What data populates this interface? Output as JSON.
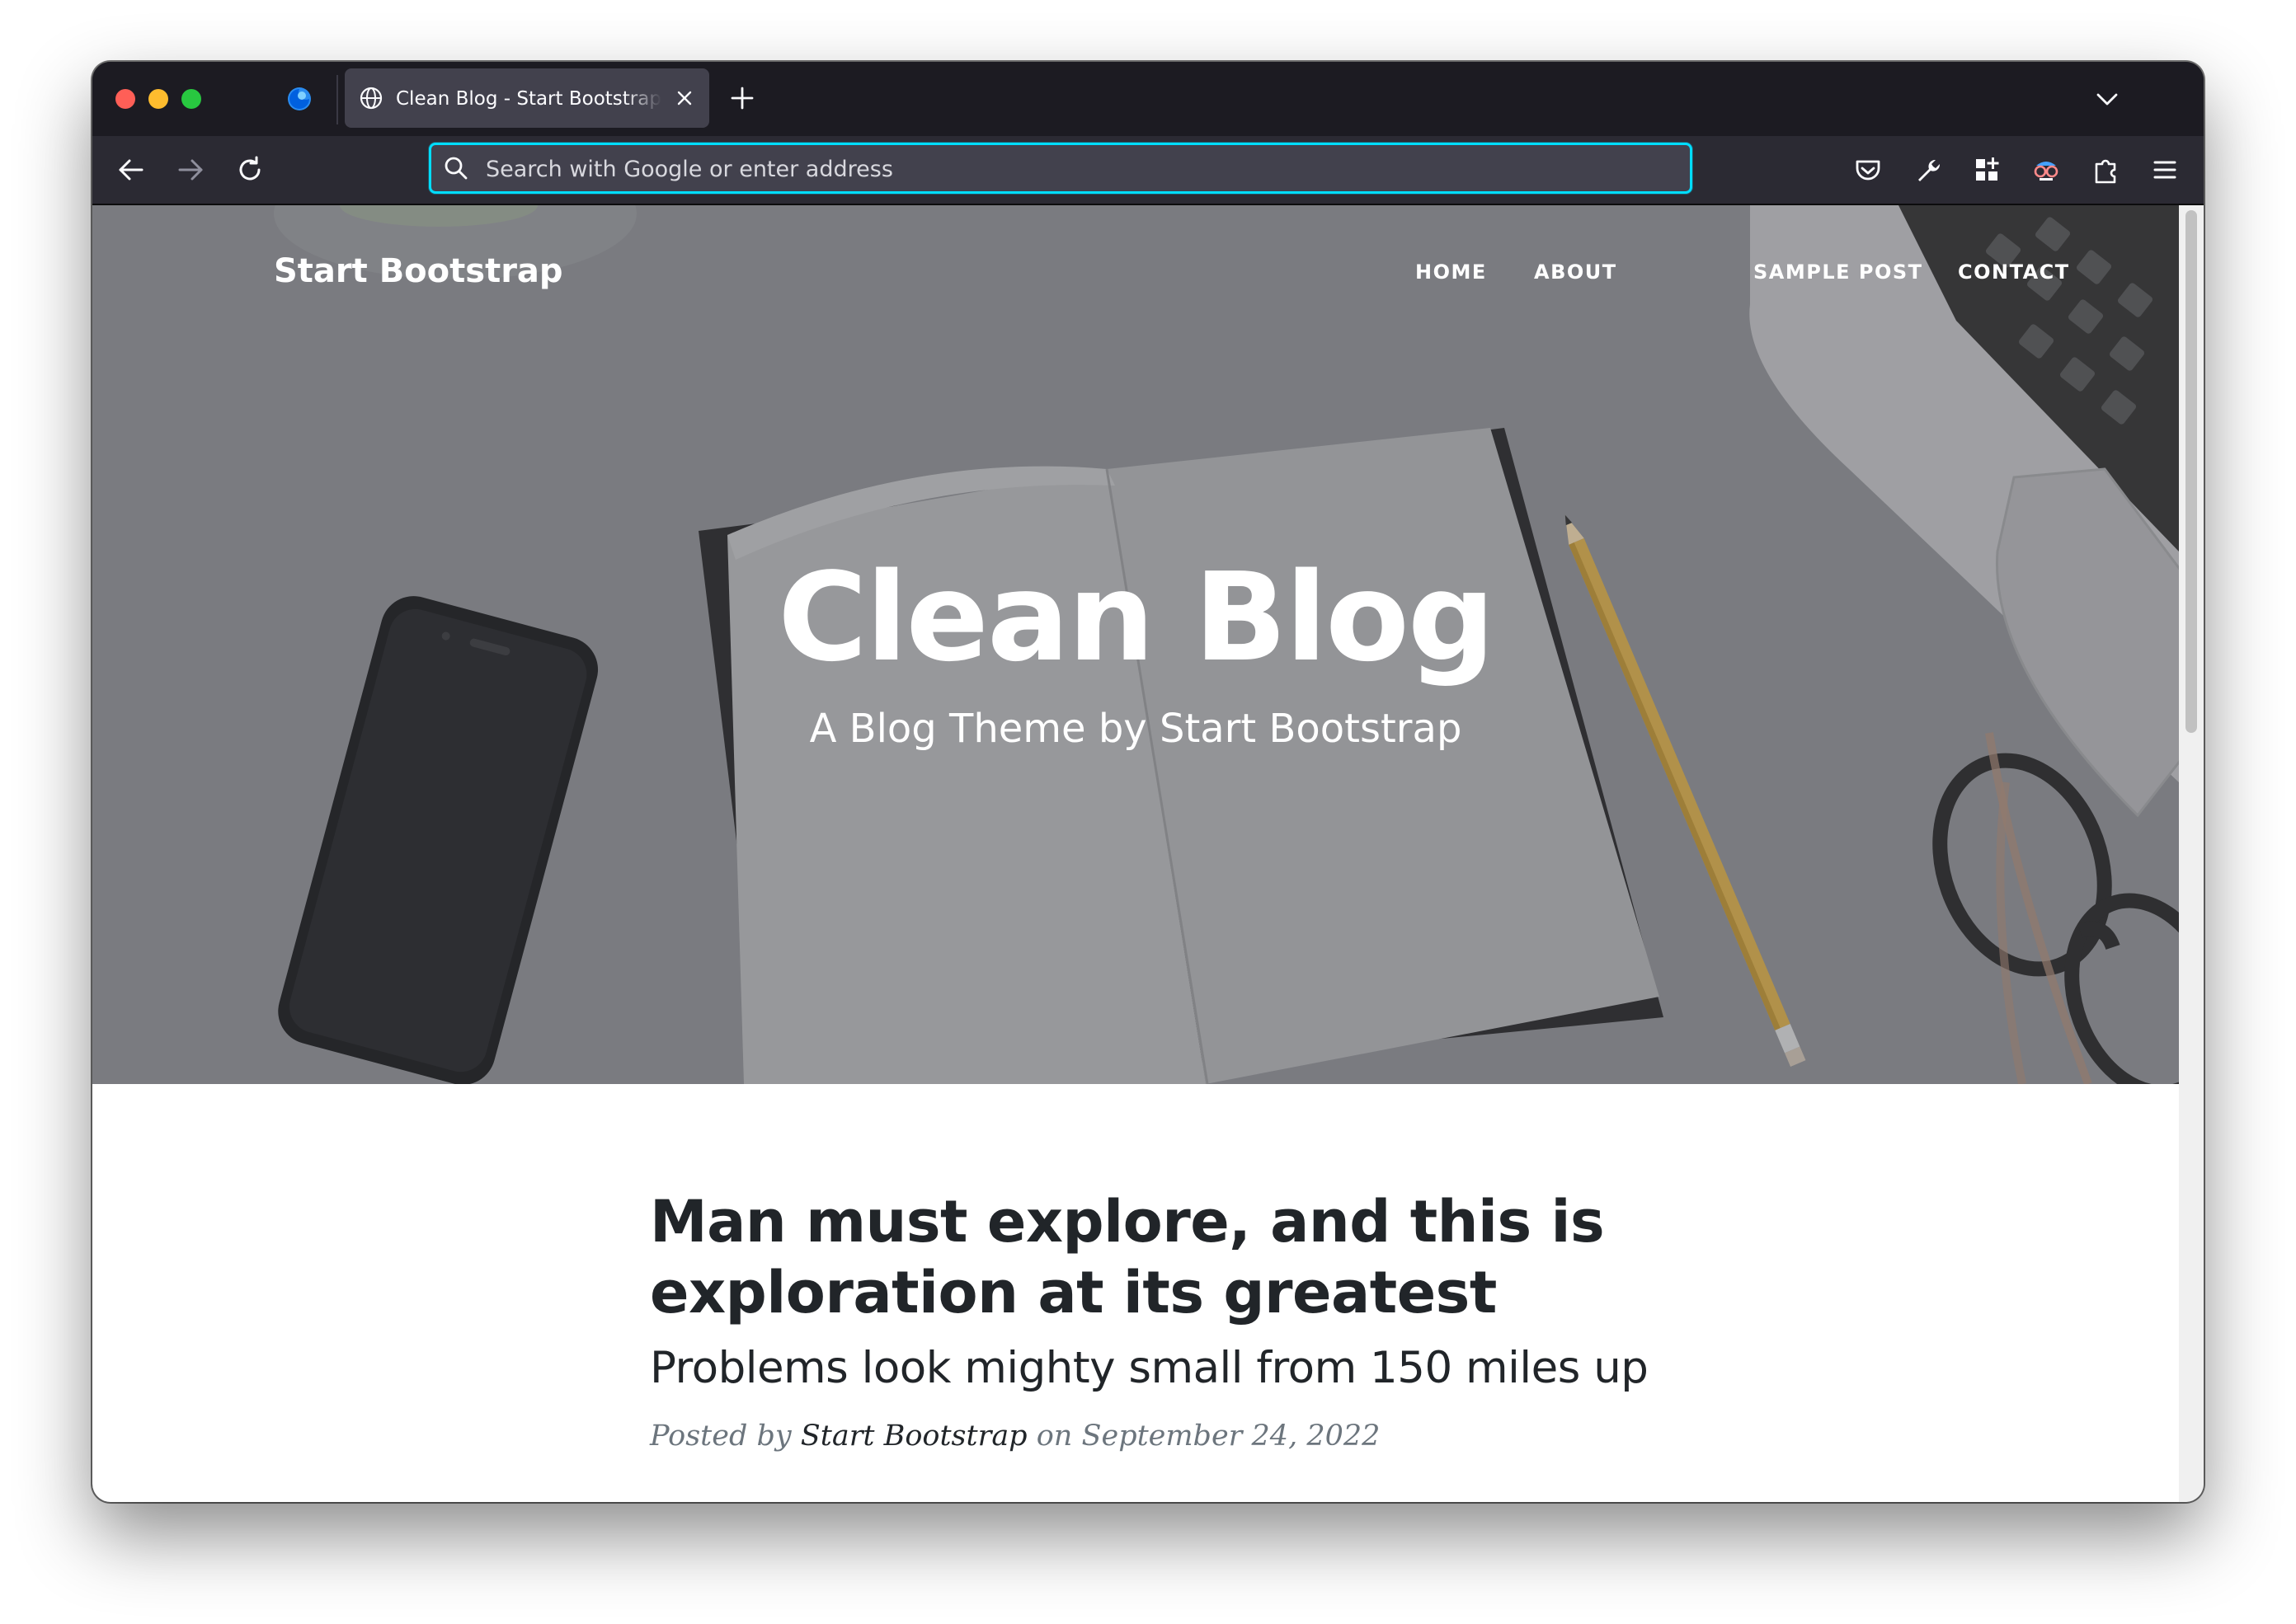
{
  "browser": {
    "tab": {
      "title": "Clean Blog - Start Bootstrap Theme",
      "close_icon": "close-icon"
    },
    "new_tab_icon": "plus-icon",
    "tab_list_icon": "chevron-down-icon",
    "urlbar": {
      "placeholder": "Search with Google or enter address",
      "value": ""
    },
    "toolbar_icons": [
      "back-arrow-icon",
      "forward-arrow-icon",
      "reload-icon",
      "pocket-icon",
      "wrench-icon",
      "extensions-grid-icon",
      "spy-glasses-icon",
      "puzzle-icon",
      "hamburger-menu-icon"
    ],
    "colors": {
      "tabstrip": "#1c1b22",
      "toolbar": "#2b2a33",
      "urlbar_focus": "#00ddff"
    }
  },
  "site": {
    "brand": "Start Bootstrap",
    "nav": [
      {
        "label": "HOME"
      },
      {
        "label": "ABOUT"
      },
      {
        "label": "SAMPLE POST"
      },
      {
        "label": "CONTACT"
      }
    ],
    "hero": {
      "title": "Clean Blog",
      "subtitle": "A Blog Theme by Start Bootstrap"
    },
    "post": {
      "title": "Man must explore, and this is exploration at its greatest",
      "subtitle": "Problems look mighty small from 150 miles up",
      "meta_prefix": "Posted by",
      "author": "Start Bootstrap",
      "meta_on": "on",
      "date": "September 24, 2022"
    }
  }
}
